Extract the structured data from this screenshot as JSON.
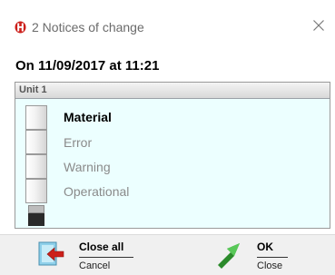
{
  "window": {
    "title": "2 Notices of change",
    "icon": "signal-tower-red-icon",
    "close_icon": "close-icon"
  },
  "heading": "On 11/09/2017 at 11:21",
  "unit_panel": {
    "header": "Unit 1",
    "background_color": "#ecffff",
    "statuses": [
      {
        "label": "Material",
        "active": true
      },
      {
        "label": "Error",
        "active": false
      },
      {
        "label": "Warning",
        "active": false
      },
      {
        "label": "Operational",
        "active": false
      }
    ]
  },
  "buttons": {
    "close_all": {
      "label": "Close all",
      "sublabel": "Cancel",
      "icon": "close-all-exit-icon"
    },
    "ok": {
      "label": "OK",
      "sublabel": "Close",
      "icon": "green-arrow-icon"
    }
  },
  "colors": {
    "accent_red": "#cc1f1a",
    "ok_green": "#3aa83a",
    "panel_bg": "#ecffff"
  }
}
